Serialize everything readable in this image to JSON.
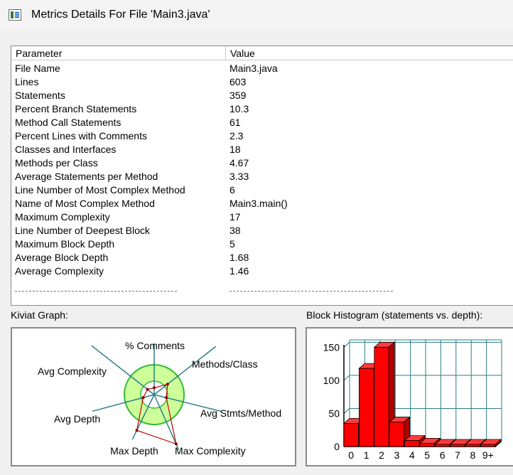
{
  "window": {
    "title": "Metrics Details For File 'Main3.java'",
    "icon": "metrics-window-icon"
  },
  "table": {
    "headers": {
      "parameter": "Parameter",
      "value": "Value"
    },
    "rows": [
      {
        "parameter": "File Name",
        "value": "Main3.java"
      },
      {
        "parameter": "Lines",
        "value": "603"
      },
      {
        "parameter": "Statements",
        "value": "359"
      },
      {
        "parameter": "Percent Branch Statements",
        "value": "10.3"
      },
      {
        "parameter": "Method Call Statements",
        "value": "61"
      },
      {
        "parameter": "Percent Lines with Comments",
        "value": "2.3"
      },
      {
        "parameter": "Classes and Interfaces",
        "value": "18"
      },
      {
        "parameter": "Methods per Class",
        "value": "4.67"
      },
      {
        "parameter": "Average Statements per Method",
        "value": "3.33"
      },
      {
        "parameter": "Line Number of Most Complex Method",
        "value": "6"
      },
      {
        "parameter": "Name of Most Complex Method",
        "value": "Main3.main()"
      },
      {
        "parameter": "Maximum Complexity",
        "value": "17"
      },
      {
        "parameter": "Line Number of Deepest Block",
        "value": "38"
      },
      {
        "parameter": "Maximum Block Depth",
        "value": "5"
      },
      {
        "parameter": "Average Block Depth",
        "value": "1.68"
      },
      {
        "parameter": "Average Complexity",
        "value": "1.46"
      }
    ]
  },
  "kiviat": {
    "label": "Kiviat Graph:",
    "axes": [
      "% Comments",
      "Methods/Class",
      "Avg Stmts/Method",
      "Max Complexity",
      "Max Depth",
      "Avg Depth",
      "Avg Complexity"
    ],
    "colors": {
      "ring": "#33bb33",
      "fill": "#ccff99",
      "polygon": "#cc0000",
      "axis": "#2a7f86"
    }
  },
  "histogram": {
    "label": "Block Histogram (statements vs. depth):",
    "colors": {
      "bar": "#ff0000",
      "grid": "#2a7f86"
    }
  },
  "chart_data": [
    {
      "type": "radar",
      "axes": [
        "% Comments",
        "Methods/Class",
        "Avg Stmts/Method",
        "Max Complexity",
        "Max Depth",
        "Avg Depth",
        "Avg Complexity"
      ],
      "values": [
        0.12,
        0.3,
        0.22,
        0.95,
        0.7,
        0.2,
        0.15
      ],
      "normal_range": [
        0.3,
        0.7
      ]
    },
    {
      "type": "bar",
      "categories": [
        "0",
        "1",
        "2",
        "3",
        "4",
        "5",
        "6",
        "7",
        "8",
        "9+"
      ],
      "values": [
        35,
        118,
        150,
        37,
        9,
        5,
        1,
        1,
        1,
        1
      ],
      "ylim": [
        0,
        160
      ],
      "yticks": [
        "0",
        "50",
        "100",
        "150"
      ],
      "grid": true
    }
  ]
}
